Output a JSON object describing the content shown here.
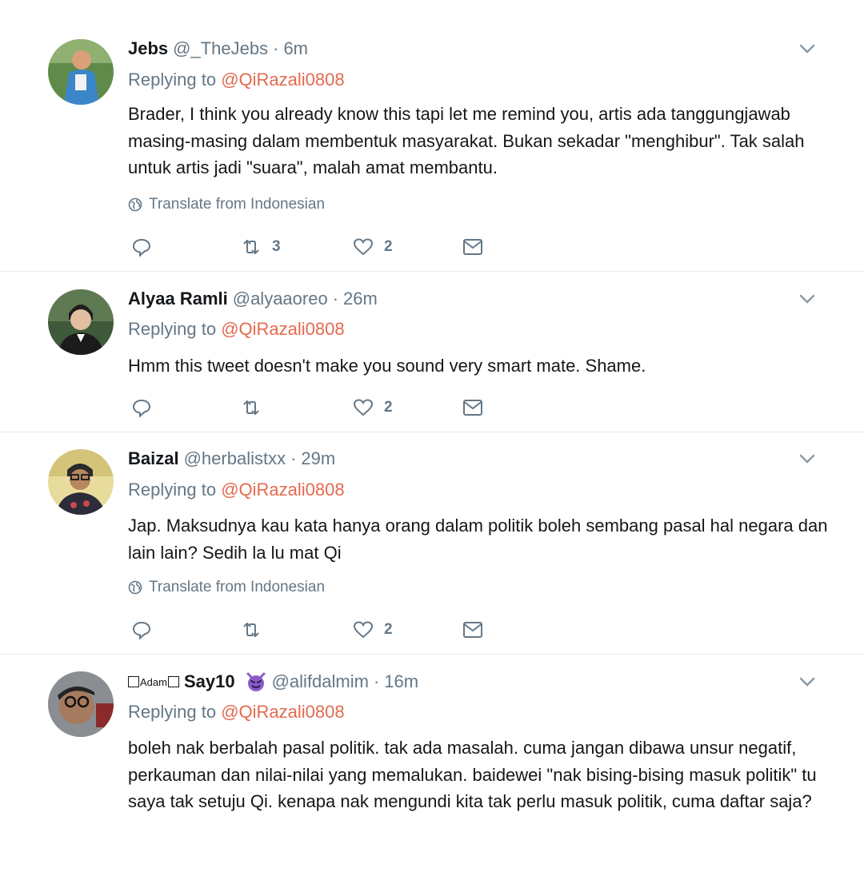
{
  "tweets": [
    {
      "name": "Jebs",
      "handle": "@_TheJebs",
      "time": "6m",
      "replying_prefix": "Replying to",
      "replying_to": "@QiRazali0808",
      "text": "Brader, I think you already know this tapi let me remind you, artis ada tanggungjawab masing-masing dalam membentuk masyarakat. Bukan sekadar \"menghibur\". Tak salah untuk artis jadi \"suara\", malah amat membantu.",
      "translate": "Translate from Indonesian",
      "retweets": "3",
      "likes": "2"
    },
    {
      "name": "Alyaa Ramli",
      "handle": "@alyaaoreo",
      "time": "26m",
      "replying_prefix": "Replying to",
      "replying_to": "@QiRazali0808",
      "text": "Hmm this tweet doesn't make you sound very smart mate. Shame.",
      "retweets": "",
      "likes": "2"
    },
    {
      "name": "Baizal",
      "handle": "@herbalistxx",
      "time": "29m",
      "replying_prefix": "Replying to",
      "replying_to": "@QiRazali0808",
      "text": "Jap. Maksudnya kau kata hanya orang dalam politik boleh sembang pasal hal negara dan lain lain? Sedih la lu mat Qi",
      "translate": "Translate from Indonesian",
      "retweets": "",
      "likes": "2"
    },
    {
      "name_sup": "Adam",
      "name": "Say10",
      "emoji": "smiling-devil-emoji",
      "handle": "@alifdalmim",
      "time": "16m",
      "replying_prefix": "Replying to",
      "replying_to": "@QiRazali0808",
      "text": "boleh nak berbalah pasal politik. tak ada masalah. cuma jangan dibawa unsur negatif, perkauman dan nilai-nilai yang memalukan. baidewei \"nak bising-bising masuk politik\" tu saya tak setuju Qi. kenapa nak mengundi kita tak perlu masuk politik, cuma daftar saja?"
    }
  ],
  "colors": {
    "text": "#14171a",
    "secondary": "#657786",
    "mention": "#e46a4e",
    "separator": "#e6ecf0"
  }
}
